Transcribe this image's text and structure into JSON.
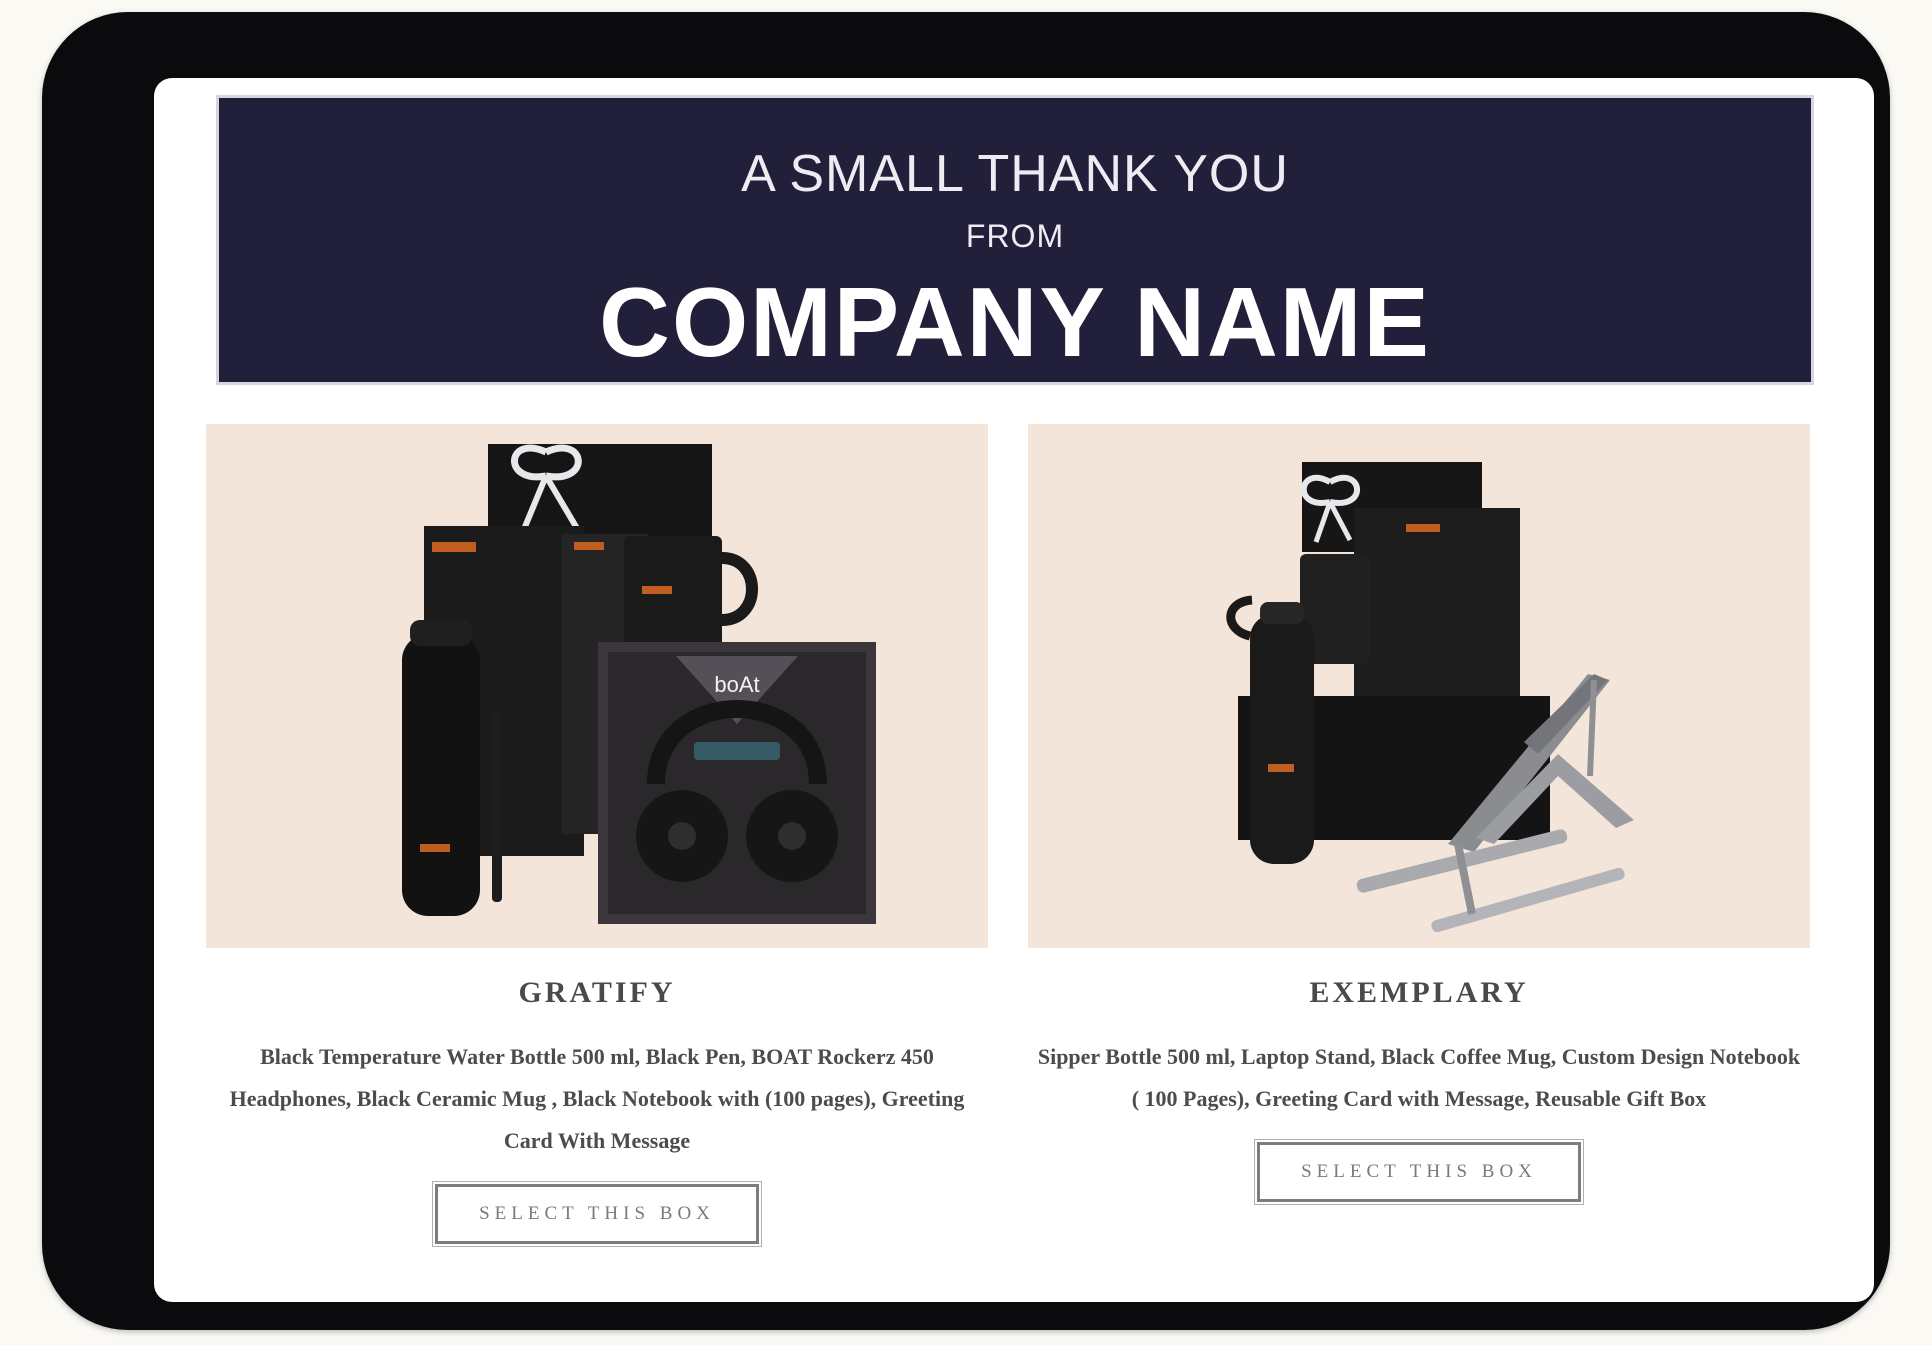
{
  "banner": {
    "line1": "A SMALL THANK YOU",
    "line2": "FROM",
    "line3": "COMPANY NAME"
  },
  "cards": [
    {
      "title": "GRATIFY",
      "description": "Black Temperature Water Bottle 500 ml, Black Pen, BOAT Rockerz 450 Headphones, Black Ceramic Mug , Black Notebook with (100 pages), Greeting Card With Message",
      "button_label": "SELECT THIS BOX",
      "headphone_brand": "boAt"
    },
    {
      "title": "EXEMPLARY",
      "description": "Sipper Bottle 500 ml, Laptop Stand, Black Coffee Mug, Custom Design Notebook ( 100 Pages), Greeting Card with Message, Reusable Gift Box",
      "button_label": "SELECT THIS BOX"
    }
  ],
  "colors": {
    "banner_bg": "#211f3a",
    "photo_bg": "#f4e5da",
    "device_frame": "#0b0b0d"
  }
}
